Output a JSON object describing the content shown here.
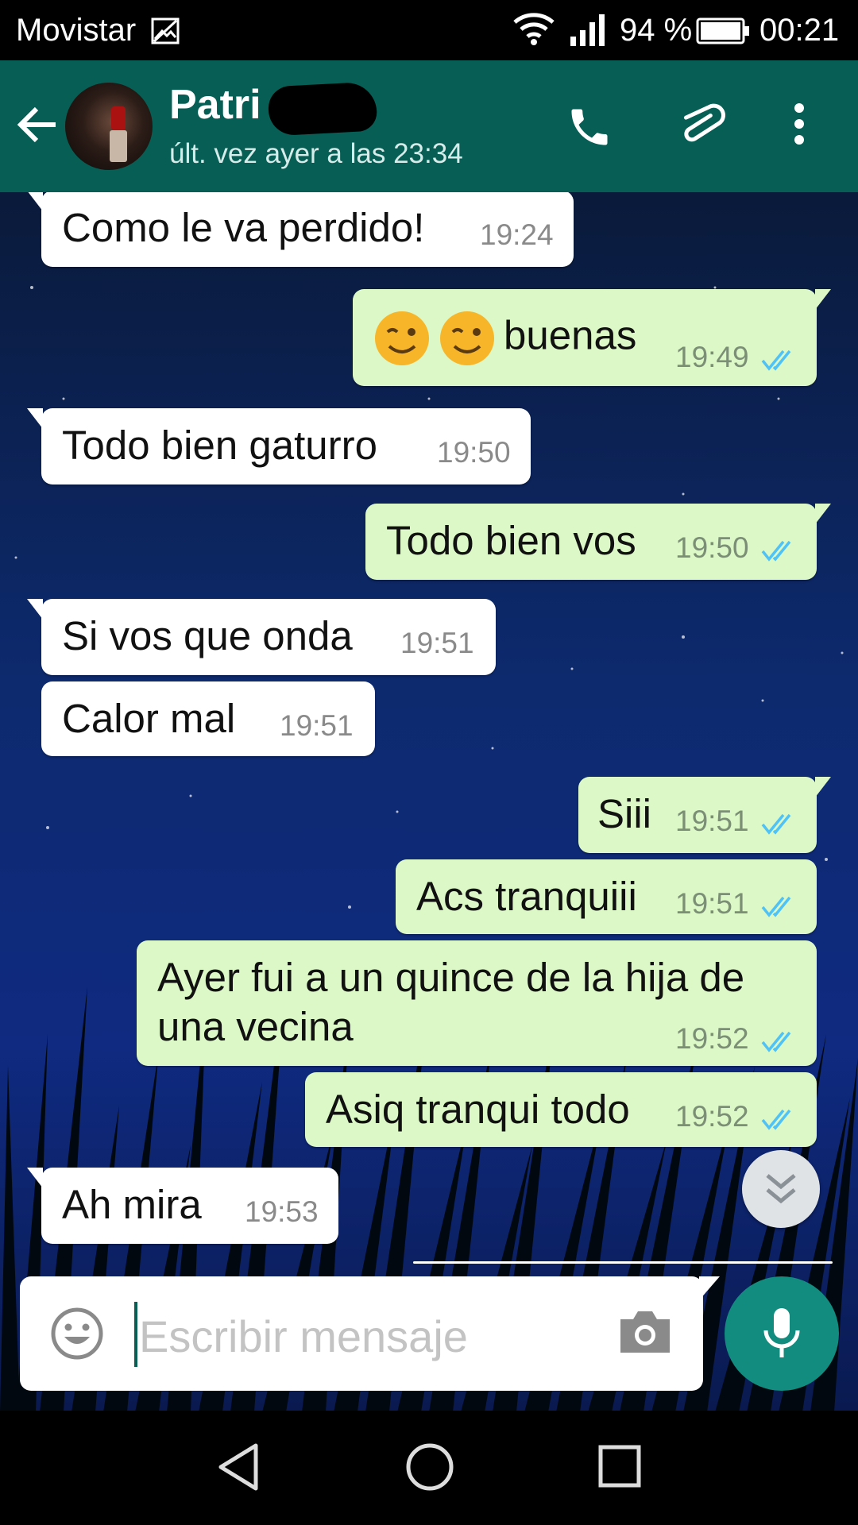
{
  "status_bar": {
    "carrier": "Movistar",
    "battery": "94 %",
    "time": "00:21"
  },
  "header": {
    "contact_name": "Patri",
    "last_seen": "últ. vez ayer a las 23:34",
    "icons": [
      "arrow-back-icon",
      "phone-icon",
      "paperclip-icon",
      "more-vert-icon"
    ],
    "color": "#075e54"
  },
  "messages": [
    {
      "dir": "in",
      "text": "Como le va perdido!",
      "time": "19:24"
    },
    {
      "dir": "out",
      "text": "buenas",
      "emoji": "winking-face x2",
      "time": "19:49",
      "status": "read"
    },
    {
      "dir": "in",
      "text": "Todo bien gaturro",
      "time": "19:50"
    },
    {
      "dir": "out",
      "text": "Todo bien vos",
      "time": "19:50",
      "status": "read"
    },
    {
      "dir": "in",
      "text": "Si vos que onda",
      "time": "19:51"
    },
    {
      "dir": "in",
      "text": "Calor mal",
      "time": "19:51"
    },
    {
      "dir": "out",
      "text": "Siii",
      "time": "19:51",
      "status": "read"
    },
    {
      "dir": "out",
      "text": "Acs tranquiii",
      "time": "19:51",
      "status": "read"
    },
    {
      "dir": "out",
      "text": "Ayer fui a un quince de la hija de una vecina",
      "time": "19:52",
      "status": "read"
    },
    {
      "dir": "out",
      "text": "Asiq tranqui todo",
      "time": "19:52",
      "status": "read"
    },
    {
      "dir": "in",
      "text": "Ah mira",
      "time": "19:53"
    }
  ],
  "composer": {
    "placeholder": "Escribir mensaje",
    "value": ""
  },
  "colors": {
    "incoming_bubble": "#ffffff",
    "outgoing_bubble": "#dcf8c6",
    "read_ticks": "#4fc3f7",
    "fab": "#128c7e"
  }
}
